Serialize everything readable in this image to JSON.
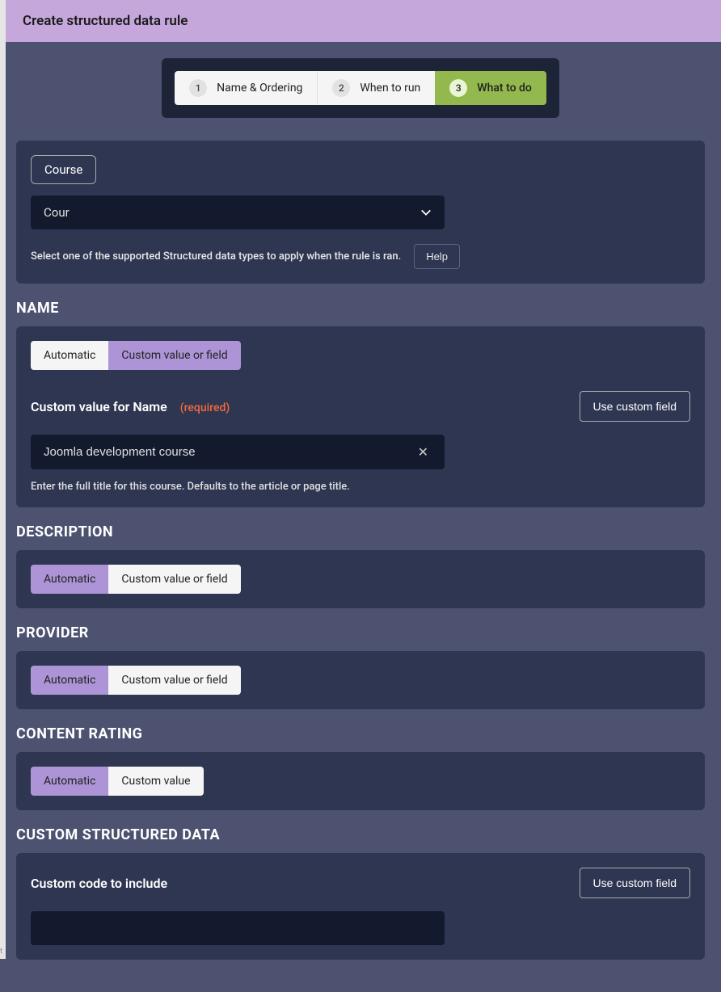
{
  "header": {
    "title": "Create structured data rule"
  },
  "stepper": {
    "steps": [
      {
        "num": "1",
        "label": "Name & Ordering"
      },
      {
        "num": "2",
        "label": "When to run"
      },
      {
        "num": "3",
        "label": "What to do"
      }
    ],
    "activeIndex": 2
  },
  "typePanel": {
    "badge": "Course",
    "selectValue": "Cour",
    "helpText": "Select one of the supported Structured data types to apply when the rule is ran.",
    "helpButton": "Help"
  },
  "sections": {
    "name": {
      "heading": "NAME",
      "options": [
        "Automatic",
        "Custom value or field"
      ],
      "selectedIndex": 1,
      "fieldLabel": "Custom value for Name",
      "requiredTag": "(required)",
      "useCustomField": "Use custom field",
      "inputValue": "Joomla development course",
      "hint": "Enter the full title for this course. Defaults to the article or page title."
    },
    "description": {
      "heading": "DESCRIPTION",
      "options": [
        "Automatic",
        "Custom value or field"
      ],
      "selectedIndex": 0
    },
    "provider": {
      "heading": "PROVIDER",
      "options": [
        "Automatic",
        "Custom value or field"
      ],
      "selectedIndex": 0
    },
    "contentRating": {
      "heading": "CONTENT RATING",
      "options": [
        "Automatic",
        "Custom value"
      ],
      "selectedIndex": 0
    },
    "customStructured": {
      "heading": "CUSTOM STRUCTURED DATA",
      "fieldLabel": "Custom code to include",
      "useCustomField": "Use custom field"
    }
  },
  "tinyText": "t"
}
